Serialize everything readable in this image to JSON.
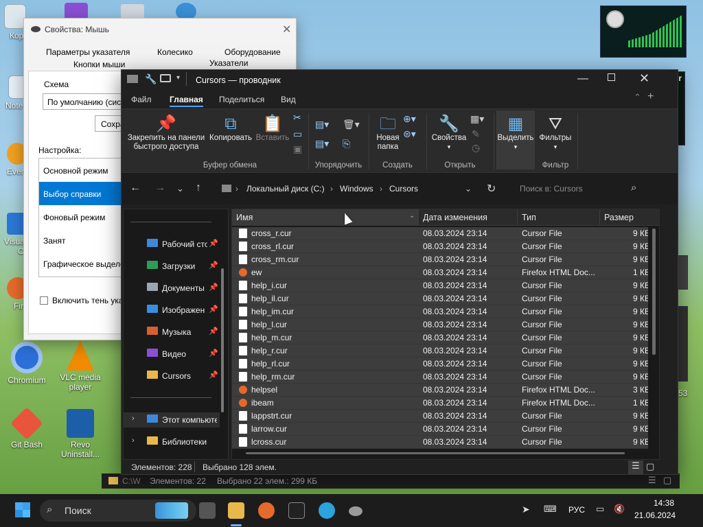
{
  "desktop": {
    "icons": [
      {
        "label": "Кор"
      },
      {
        "label": "Note"
      },
      {
        "label": "Ever"
      },
      {
        "label": "Visua\nC"
      },
      {
        "label": "Fir"
      },
      {
        "label": "Chromium"
      },
      {
        "label": "VLC media player"
      },
      {
        "label": "Git Bash"
      },
      {
        "label": "Revo Uninstall..."
      }
    ],
    "right_partial": {
      "monitor": "onitor",
      "number": "53"
    }
  },
  "mouse_dialog": {
    "title": "Свойства: Мышь",
    "tabs_row1": [
      "Параметры указателя",
      "Колесико",
      "Оборудование"
    ],
    "tabs_row2": [
      "Кнопки мыши",
      "Указатели"
    ],
    "scheme_label": "Схема",
    "scheme_value": "По умолчанию (систем",
    "save_button": "Сохран",
    "settings_label": "Настройка:",
    "list": [
      "Основной режим",
      "Выбор справки",
      "Фоновый режим",
      "Занят",
      "Графическое выделен"
    ],
    "shadow_checkbox": "Включить тень указа"
  },
  "explorer": {
    "title": "Cursors — проводник",
    "menu": [
      "Файл",
      "Главная",
      "Поделиться",
      "Вид"
    ],
    "ribbon": {
      "pin": "Закрепить на панели быстрого доступа",
      "copy": "Копировать",
      "paste": "Вставить",
      "new_folder": "Новая папка",
      "properties": "Свойства",
      "select": "Выделить",
      "filters": "Фильтры",
      "groups": [
        "Буфер обмена",
        "Упорядочить",
        "Создать",
        "Открыть",
        "Фильтр"
      ]
    },
    "address": [
      "Локальный диск (C:)",
      "Windows",
      "Cursors"
    ],
    "search_placeholder": "Поиск в: Cursors",
    "nav": [
      "Рабочий сто",
      "Загрузки",
      "Документы",
      "Изображен",
      "Музыка",
      "Видео",
      "Cursors",
      "Этот компьюте",
      "Библиотеки"
    ],
    "columns": [
      "Имя",
      "Дата изменения",
      "Тип",
      "Размер"
    ],
    "files": [
      {
        "name": "cross_r.cur",
        "date": "08.03.2024 23:14",
        "type": "Cursor File",
        "size": "9 КБ",
        "icon": "cursor-file-icon"
      },
      {
        "name": "cross_rl.cur",
        "date": "08.03.2024 23:14",
        "type": "Cursor File",
        "size": "9 КБ",
        "icon": "cursor-file-icon"
      },
      {
        "name": "cross_rm.cur",
        "date": "08.03.2024 23:14",
        "type": "Cursor File",
        "size": "9 КБ",
        "icon": "cursor-file-icon"
      },
      {
        "name": "ew",
        "date": "08.03.2024 23:14",
        "type": "Firefox HTML Doc...",
        "size": "1 КБ",
        "icon": "firefox-html-icon"
      },
      {
        "name": "help_i.cur",
        "date": "08.03.2024 23:14",
        "type": "Cursor File",
        "size": "9 КБ",
        "icon": "cursor-file-icon"
      },
      {
        "name": "help_il.cur",
        "date": "08.03.2024 23:14",
        "type": "Cursor File",
        "size": "9 КБ",
        "icon": "cursor-file-icon"
      },
      {
        "name": "help_im.cur",
        "date": "08.03.2024 23:14",
        "type": "Cursor File",
        "size": "9 КБ",
        "icon": "cursor-file-icon"
      },
      {
        "name": "help_l.cur",
        "date": "08.03.2024 23:14",
        "type": "Cursor File",
        "size": "9 КБ",
        "icon": "cursor-file-icon"
      },
      {
        "name": "help_m.cur",
        "date": "08.03.2024 23:14",
        "type": "Cursor File",
        "size": "9 КБ",
        "icon": "cursor-file-icon"
      },
      {
        "name": "help_r.cur",
        "date": "08.03.2024 23:14",
        "type": "Cursor File",
        "size": "9 КБ",
        "icon": "cursor-file-icon"
      },
      {
        "name": "help_rl.cur",
        "date": "08.03.2024 23:14",
        "type": "Cursor File",
        "size": "9 КБ",
        "icon": "cursor-file-icon"
      },
      {
        "name": "help_rm.cur",
        "date": "08.03.2024 23:14",
        "type": "Cursor File",
        "size": "9 КБ",
        "icon": "cursor-file-icon"
      },
      {
        "name": "helpsel",
        "date": "08.03.2024 23:14",
        "type": "Firefox HTML Doc...",
        "size": "3 КБ",
        "icon": "firefox-html-icon"
      },
      {
        "name": "ibeam",
        "date": "08.03.2024 23:14",
        "type": "Firefox HTML Doc...",
        "size": "1 КБ",
        "icon": "firefox-html-icon"
      },
      {
        "name": "lappstrt.cur",
        "date": "08.03.2024 23:14",
        "type": "Cursor File",
        "size": "9 КБ",
        "icon": "cursor-file-icon"
      },
      {
        "name": "larrow.cur",
        "date": "08.03.2024 23:14",
        "type": "Cursor File",
        "size": "9 КБ",
        "icon": "cursor-file-icon"
      },
      {
        "name": "lcross.cur",
        "date": "08.03.2024 23:14",
        "type": "Cursor File",
        "size": "9 КБ",
        "icon": "cursor-file-icon"
      }
    ],
    "status_count": "Элементов: 228",
    "status_selected": "Выбрано 128 элем."
  },
  "behind_status": {
    "prefix": "C:\\W",
    "count": "Элементов: 22",
    "selected": "Выбрано 22 элем.: 299 КБ"
  },
  "taskbar": {
    "search": "Поиск",
    "lang": "РУС",
    "time": "14:38",
    "date": "21.06.2024"
  }
}
